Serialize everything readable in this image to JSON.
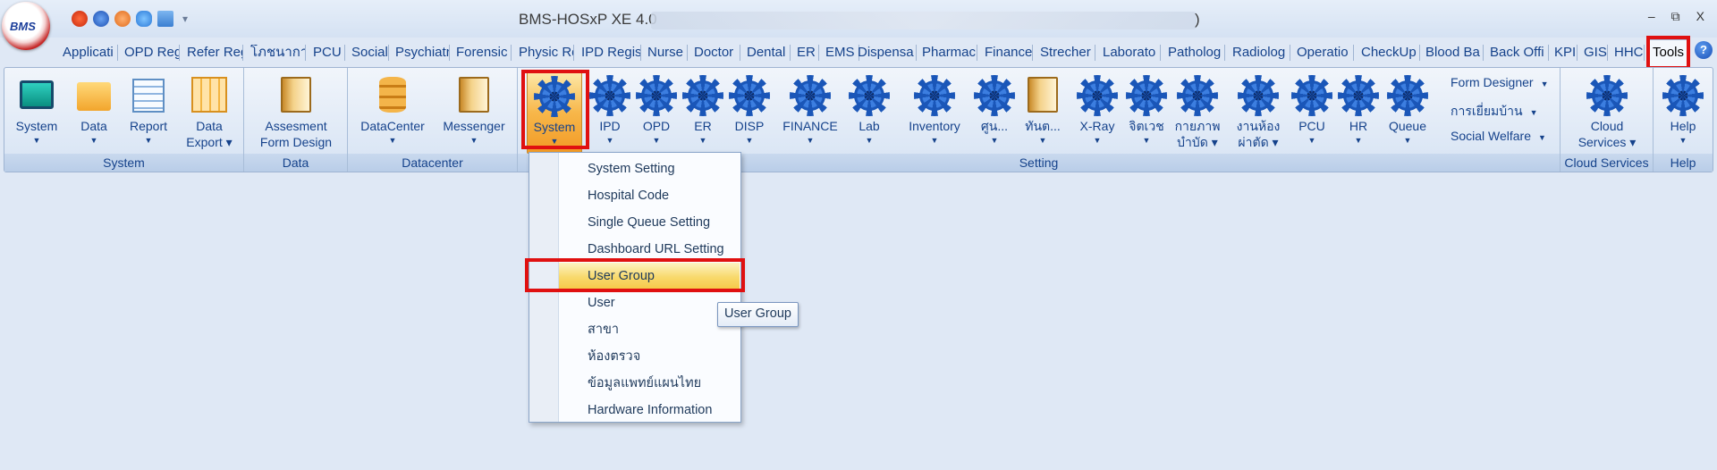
{
  "app": {
    "logo_text": "BMS",
    "window_title": "BMS-HOSxP XE 4.0",
    "window_title_close": ")",
    "controls": {
      "minimize": "–",
      "restore": "⧉",
      "close": "X"
    }
  },
  "menu_tabs": [
    "Applicati",
    "OPD Reg",
    "Refer Reg",
    "โภชนาการ",
    "PCU",
    "Social",
    "Psychiatr",
    "Forensic",
    "Physic Re",
    "IPD Regis",
    "Nurse",
    "Doctor",
    "Dental",
    "ER",
    "EMS",
    "Dispensa",
    "Pharmac",
    "Finance",
    "Strecher",
    "Laborato",
    "Patholog",
    "Radiolog",
    "Operatio",
    "CheckUp",
    "Blood Ba",
    "Back Offi",
    "KPI",
    "GIS",
    "HHC",
    "Tools"
  ],
  "help_icon_text": "?",
  "ribbon": {
    "groups": {
      "system": "System",
      "data": "Data",
      "datacenter": "Datacenter",
      "setting": "Setting",
      "cloud": "Cloud Services",
      "help": "Help"
    },
    "system_buttons": [
      "System",
      "Data",
      "Report",
      "Data",
      "Export"
    ],
    "data_button": [
      "Assesment",
      "Form Design"
    ],
    "datacenter_buttons": [
      "DataCenter",
      "Messenger"
    ],
    "setting_buttons": [
      "System",
      "IPD",
      "OPD",
      "ER",
      "DISP",
      "FINANCE",
      "Lab",
      "Inventory",
      "ศูน...",
      "ทันต...",
      "X-Ray",
      "จิตเวช",
      "กายภาพ",
      "บำบัด",
      "งานห้อง",
      "ผ่าตัด",
      "PCU",
      "HR",
      "Queue"
    ],
    "setting_side": [
      "Form Designer",
      "การเยี่ยมบ้าน",
      "Social Welfare"
    ],
    "cloud_button": [
      "Cloud",
      "Services"
    ],
    "help_button": "Help"
  },
  "dropdown": {
    "items": [
      "System Setting",
      "Hospital Code",
      "Single Queue Setting",
      "Dashboard URL Setting",
      "User Group",
      "User",
      "สาขา",
      "ห้องตรวจ",
      "ข้อมูลแพทย์แผนไทย",
      "Hardware Information"
    ],
    "highlighted": "User Group"
  },
  "tooltip": "User Group",
  "colors": {
    "highlight_box": "#e01010",
    "ribbon_text": "#15428b",
    "selected_button": "#f7b74a"
  }
}
